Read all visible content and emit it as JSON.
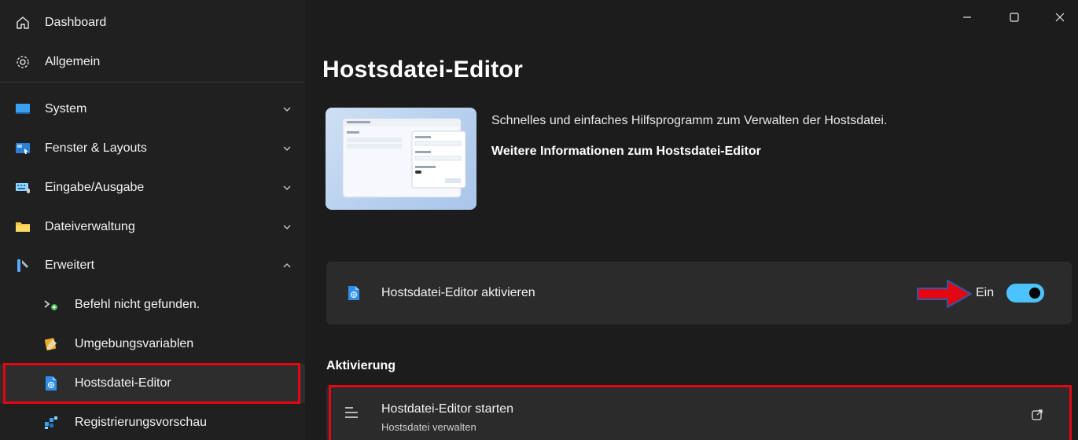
{
  "window": {
    "minimize_icon": "minimize-icon",
    "maximize_icon": "maximize-icon",
    "close_icon": "close-icon"
  },
  "sidebar": {
    "items": [
      {
        "label": "Dashboard",
        "icon": "home-icon"
      },
      {
        "label": "Allgemein",
        "icon": "gear-icon"
      },
      {
        "label": "System",
        "icon": "monitor-icon"
      },
      {
        "label": "Fenster & Layouts",
        "icon": "window-layout-icon"
      },
      {
        "label": "Eingabe/Ausgabe",
        "icon": "keyboard-icon"
      },
      {
        "label": "Dateiverwaltung",
        "icon": "folder-icon"
      },
      {
        "label": "Erweitert",
        "icon": "tools-icon"
      },
      {
        "label": "Befehl nicht gefunden.",
        "icon": "terminal-plus-icon"
      },
      {
        "label": "Umgebungsvariablen",
        "icon": "variables-icon"
      },
      {
        "label": "Hostsdatei-Editor",
        "icon": "hosts-file-icon"
      },
      {
        "label": "Registrierungsvorschau",
        "icon": "registry-icon"
      }
    ]
  },
  "main": {
    "title": "Hostsdatei-Editor",
    "description": "Schnelles und einfaches Hilfsprogramm zum Verwalten der Hostsdatei.",
    "more_info_link": "Weitere Informationen zum Hostsdatei-Editor",
    "enable_card": {
      "label": "Hostsdatei-Editor aktivieren",
      "toggle_state": "Ein",
      "toggle_on": true
    },
    "section_heading": "Aktivierung",
    "launch_card": {
      "title": "Hostdatei-Editor starten",
      "subtitle": "Hostsdatei verwalten"
    }
  },
  "colors": {
    "accent": "#4cc2ff",
    "highlight_red": "#e30613",
    "background": "#202020",
    "card": "#2b2b2b"
  }
}
